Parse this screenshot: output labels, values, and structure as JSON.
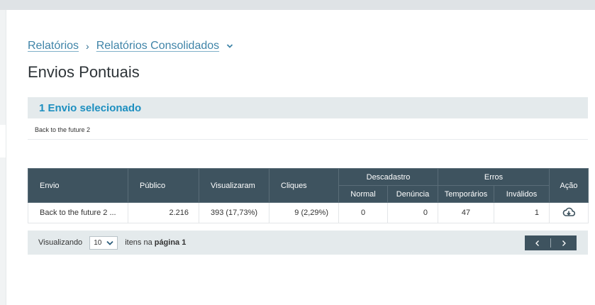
{
  "breadcrumb": {
    "items": [
      "Relatórios",
      "Relatórios Consolidados"
    ],
    "separator": "›"
  },
  "page": {
    "title": "Envios Pontuais"
  },
  "selection": {
    "header": "1 Envio selecionado",
    "items": [
      "Back to the future 2"
    ]
  },
  "table": {
    "headers": {
      "envio": "Envio",
      "publico": "Público",
      "visualizaram": "Visualizaram",
      "cliques": "Cliques",
      "descadastro": "Descadastro",
      "normal": "Normal",
      "denuncia": "Denúncia",
      "erros": "Erros",
      "temporarios": "Temporários",
      "invalidos": "Inválidos",
      "acao": "Ação"
    },
    "rows": [
      {
        "envio": "Back to the future 2 ...",
        "publico": "2.216",
        "visualizaram": "393 (17,73%)",
        "cliques": "9 (2,29%)",
        "normal": "0",
        "denuncia": "0",
        "temporarios": "47",
        "invalidos": "1",
        "action_icon": "cloud-download-icon"
      }
    ]
  },
  "pagination": {
    "label_before": "Visualizando",
    "page_size": "10",
    "label_after": "itens na",
    "page_label": "página 1"
  },
  "colors": {
    "header_bg": "#3e535f",
    "link": "#3f84a8",
    "accent": "#1d8fc0",
    "panel_bg": "#e4eaec"
  }
}
